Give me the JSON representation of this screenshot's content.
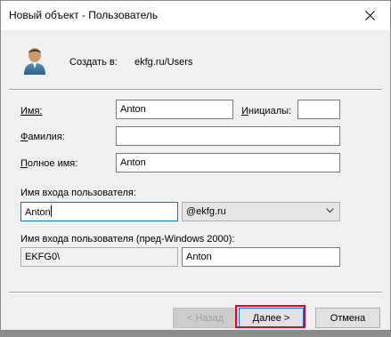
{
  "window": {
    "title": "Новый объект - Пользователь",
    "close_icon": "close-icon"
  },
  "header": {
    "create_label": "Создать в:",
    "create_path": "ekfg.ru/Users",
    "avatar_icon": "user-avatar-icon"
  },
  "form": {
    "first_name": {
      "label": "Имя:",
      "value": "Anton"
    },
    "initials": {
      "label": "Инициалы:",
      "value": ""
    },
    "last_name": {
      "label": "Фамилия:",
      "value": ""
    },
    "full_name": {
      "label": "Полное имя:",
      "value": "Anton"
    },
    "logon_name": {
      "label": "Имя входа пользователя:",
      "value": "Anton"
    },
    "domain_suffix": {
      "value": "@ekfg.ru"
    },
    "pre2000": {
      "label": "Имя входа пользователя (пред-Windows 2000):",
      "domain": "EKFG0\\",
      "name": "Anton"
    }
  },
  "buttons": {
    "back": "< Назад",
    "next": "Далее >",
    "cancel": "Отмена"
  },
  "colors": {
    "focus_border": "#0078d7",
    "highlight": "#e0001a",
    "background": "#f0f0f0"
  }
}
